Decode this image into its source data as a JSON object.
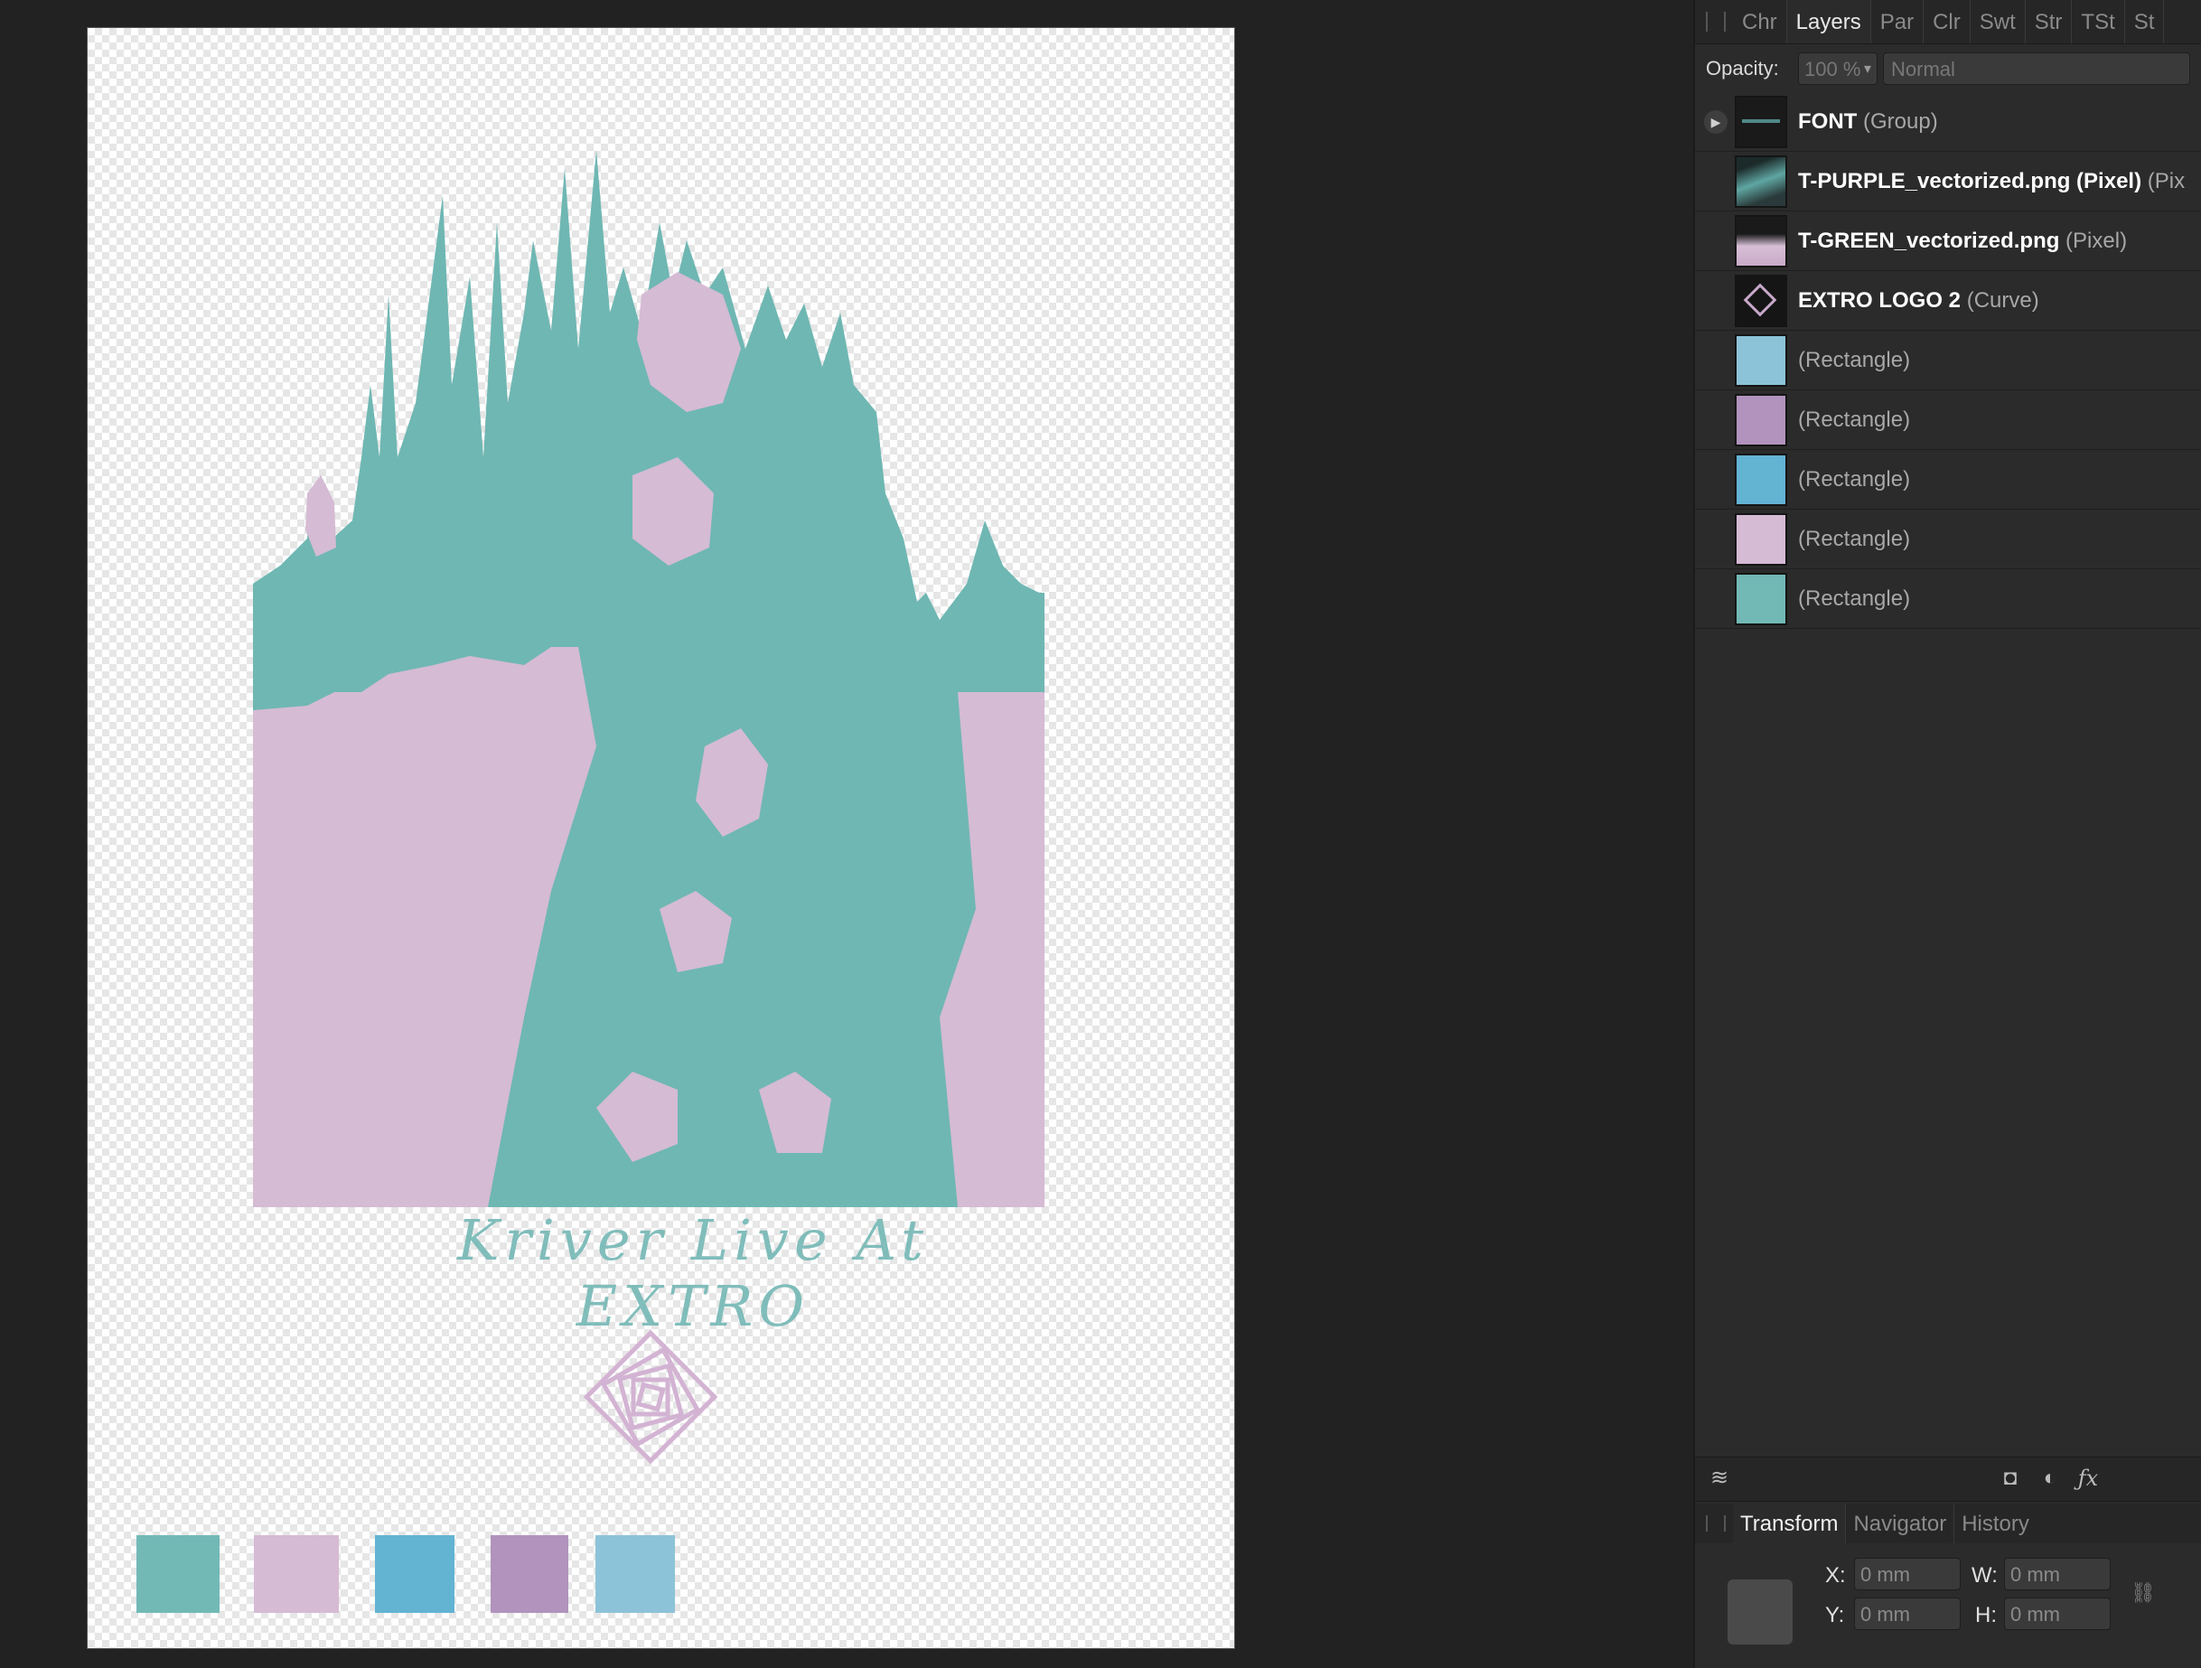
{
  "panel": {
    "tabs": [
      "Chr",
      "Layers",
      "Par",
      "Clr",
      "Swt",
      "Str",
      "TSt",
      "St"
    ],
    "active_tab": "Layers",
    "opacity_label": "Opacity:",
    "opacity_value": "100 %",
    "blend_mode": "Normal",
    "layers": [
      {
        "name": "FONT",
        "type": " (Group)",
        "expandable": true,
        "thumb": "font-group"
      },
      {
        "name": "T-PURPLE_vectorized.png (Pixel)",
        "type": " (Pix",
        "expandable": false,
        "thumb": "purple-pixel"
      },
      {
        "name": "T-GREEN_vectorized.png",
        "type": " (Pixel)",
        "expandable": false,
        "thumb": "green-pixel"
      },
      {
        "name": "EXTRO LOGO 2",
        "type": " (Curve)",
        "expandable": false,
        "thumb": "logo-curve"
      },
      {
        "name": "",
        "type": "(Rectangle)",
        "expandable": false,
        "thumb": "#8dc3d8"
      },
      {
        "name": "",
        "type": "(Rectangle)",
        "expandable": false,
        "thumb": "#b193bd"
      },
      {
        "name": "",
        "type": "(Rectangle)",
        "expandable": false,
        "thumb": "#63b3d3"
      },
      {
        "name": "",
        "type": "(Rectangle)",
        "expandable": false,
        "thumb": "#d6bbd5"
      },
      {
        "name": "",
        "type": "(Rectangle)",
        "expandable": false,
        "thumb": "#72b9b6"
      }
    ],
    "bottom_tabs": [
      "Transform",
      "Navigator",
      "History"
    ],
    "bottom_active_tab": "Transform",
    "transform": {
      "x_label": "X:",
      "x_value": "0 mm",
      "y_label": "Y:",
      "y_value": "0 mm",
      "w_label": "W:",
      "w_value": "0 mm",
      "h_label": "H:",
      "h_value": "0 mm"
    }
  },
  "document": {
    "font_text": "Kriver Live At EXTRO",
    "swatches": [
      "#72b9b6",
      "#d6bbd5",
      "#63b3d3",
      "#b193bd",
      "#8dc3d8"
    ],
    "art_colors": {
      "green": "#6fb7b3",
      "pink": "#d5bbd4"
    }
  }
}
